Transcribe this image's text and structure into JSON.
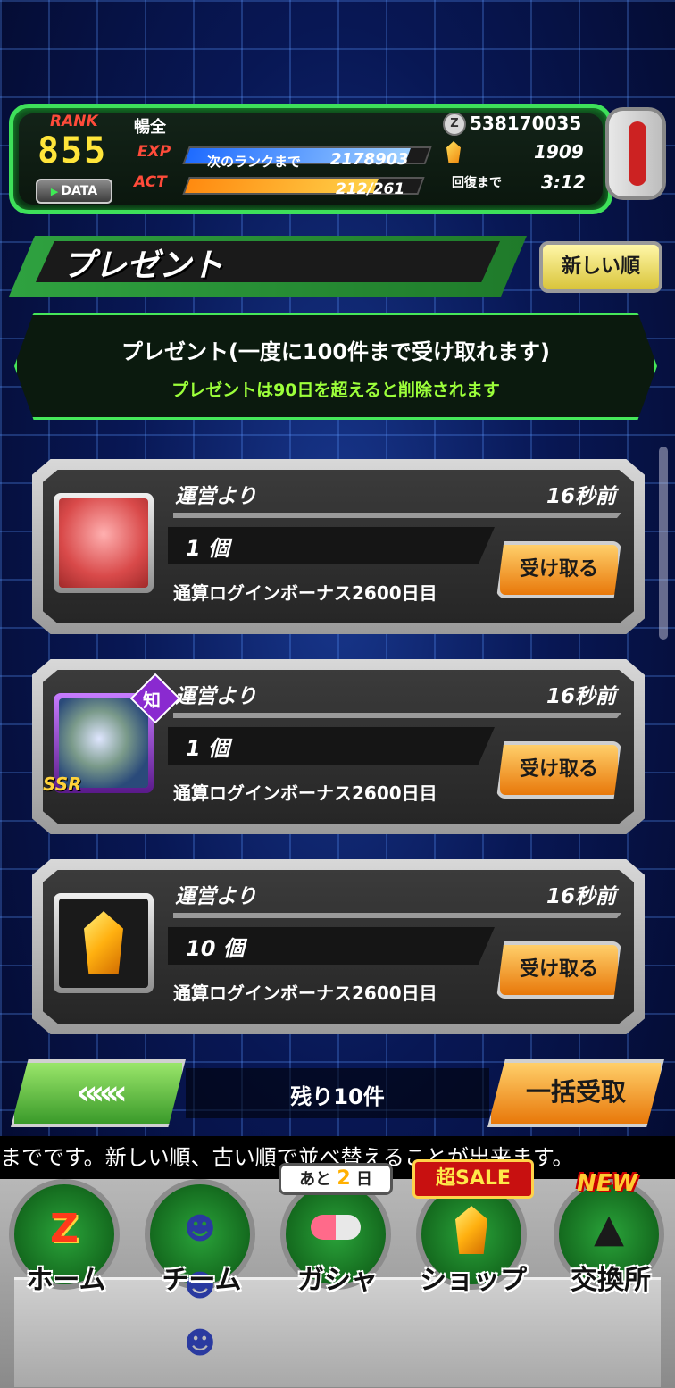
{
  "status": {
    "rank_label": "RANK",
    "rank": "855",
    "player_name": "暢全",
    "exp_label": "EXP",
    "exp_next_label": "次のランクまで",
    "exp_next_value": "2178903",
    "exp_fill": 0.92,
    "act_label": "ACT",
    "act_value": "212/261",
    "act_fill": 0.81,
    "data_button": "DATA",
    "zeni": "538170035",
    "stones": "1909",
    "recover_label": "回復まで",
    "recover_time": "3:12"
  },
  "header": {
    "title": "プレゼント",
    "sort_button": "新しい順"
  },
  "notice": {
    "line1": "プレゼント(一度に100件まで受け取れます)",
    "line2": "プレゼントは90日を超えると削除されます"
  },
  "presents": [
    {
      "from": "運営より",
      "time": "16秒前",
      "qty": "1 個",
      "desc": "通算ログインボーナス2600日目",
      "button": "受け取る",
      "item": "capsule"
    },
    {
      "from": "運営より",
      "time": "16秒前",
      "qty": "1 個",
      "desc": "通算ログインボーナス2600日目",
      "button": "受け取る",
      "item": "ssr-card",
      "type_badge": "知",
      "rarity": "SSR"
    },
    {
      "from": "運営より",
      "time": "16秒前",
      "qty": "10 個",
      "desc": "通算ログインボーナス2600日目",
      "button": "受け取る",
      "item": "dragon-stone"
    }
  ],
  "footer": {
    "back_button": "«««",
    "remaining": "残り10件",
    "bulk_button": "一括受取"
  },
  "ticker": "までです。新しい順、古い順で並べ替えることが出来ます。",
  "nav": {
    "items": [
      {
        "label": "ホーム"
      },
      {
        "label": "チーム"
      },
      {
        "label": "ガシャ"
      },
      {
        "label": "ショップ"
      },
      {
        "label": "交換所"
      }
    ],
    "gasha_badge_prefix": "あと",
    "gasha_badge_days": "2",
    "gasha_badge_suffix": "日",
    "shop_badge": "超SALE",
    "exchange_badge": "NEW"
  },
  "colors": {
    "accent_green": "#3ee05a",
    "button_orange": "#e8780a",
    "notice_green": "#9cff3a"
  }
}
